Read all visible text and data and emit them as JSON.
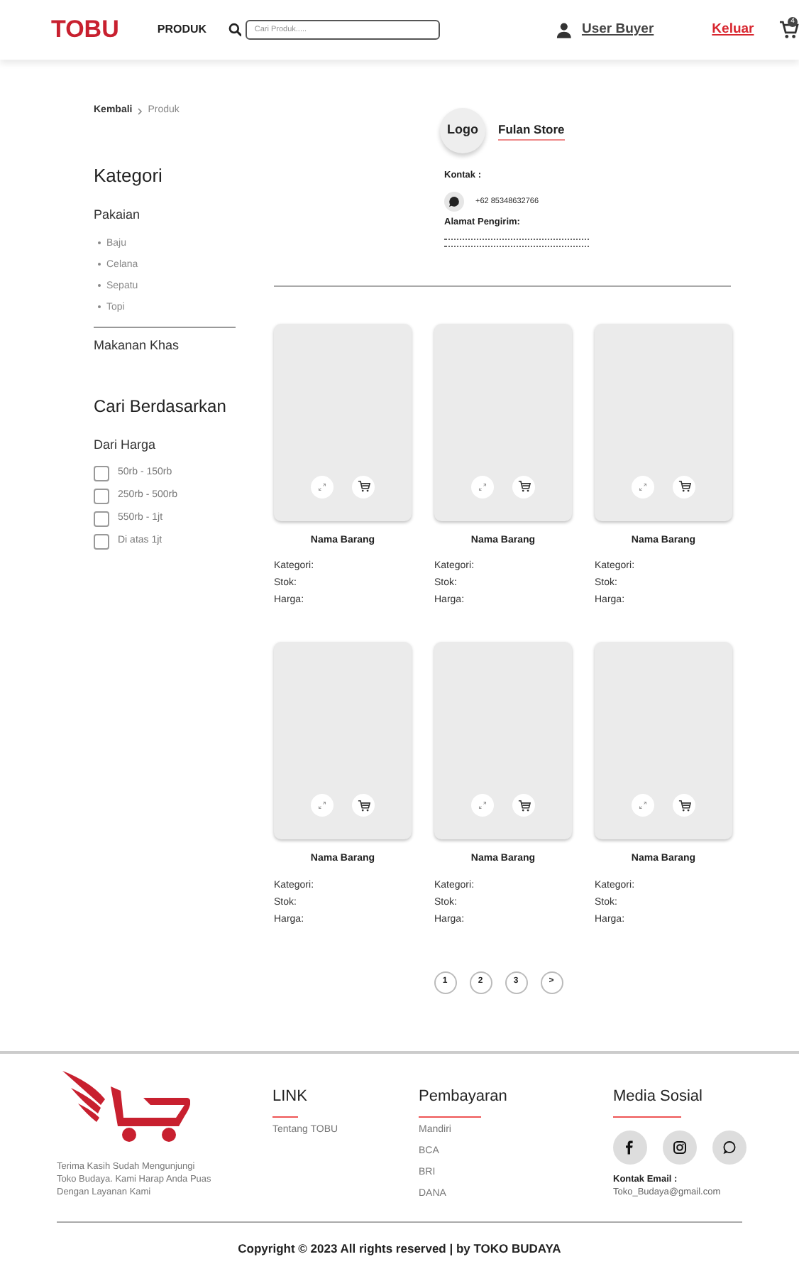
{
  "header": {
    "logo": "TOBU",
    "nav": "PRODUK",
    "search": {
      "placeholder": "Cari Produk....."
    },
    "user": "User Buyer",
    "logout": "Keluar",
    "cart_count": "4"
  },
  "breadcrumb": [
    "Kembali",
    "Produk"
  ],
  "sidebar": {
    "title": "Kategori",
    "categories": [
      {
        "label": "Pakaian",
        "children": [
          {
            "label": "Baju"
          },
          {
            "label": "Celana"
          },
          {
            "label": "Sepatu"
          },
          {
            "label": "Topi"
          }
        ]
      },
      {
        "label": "Makanan Khas"
      }
    ],
    "filter_title": "Cari Berdasarkan",
    "filter_group": "Dari Harga",
    "filters": [
      {
        "label": "50rb - 150rb",
        "checked": false
      },
      {
        "label": "250rb - 500rb",
        "checked": false
      },
      {
        "label": "550rb - 1jt",
        "checked": false
      },
      {
        "label": "Di atas 1jt",
        "checked": false
      }
    ]
  },
  "store": {
    "logo": "Logo",
    "name": "Fulan Store",
    "contact_label": "Kontak :",
    "phone": "+62 85348632766",
    "address_label": "Alamat Pengirim:"
  },
  "products": [
    {
      "name": "Nama Barang",
      "fields": [
        "Kategori:",
        "Stok:",
        "Harga:"
      ]
    },
    {
      "name": "Nama Barang",
      "fields": [
        "Kategori:",
        "Stok:",
        "Harga:"
      ]
    },
    {
      "name": "Nama Barang",
      "fields": [
        "Kategori:",
        "Stok:",
        "Harga:"
      ]
    },
    {
      "name": "Nama Barang",
      "fields": [
        "Kategori:",
        "Stok:",
        "Harga:"
      ]
    },
    {
      "name": "Nama Barang",
      "fields": [
        "Kategori:",
        "Stok:",
        "Harga:"
      ]
    },
    {
      "name": "Nama Barang",
      "fields": [
        "Kategori:",
        "Stok:",
        "Harga:"
      ]
    }
  ],
  "pagination": [
    "1",
    "2",
    "3",
    ">"
  ],
  "footer": {
    "tagline": "Terima Kasih Sudah Mengunjungi Toko Budaya. Kami Harap Anda Puas Dengan Layanan Kami",
    "columns": [
      {
        "title": "LINK",
        "items": [
          "Tentang TOBU"
        ]
      },
      {
        "title": "Pembayaran",
        "items": [
          "Mandiri",
          "BCA",
          "BRI",
          "DANA"
        ]
      }
    ],
    "social_title": "Media Sosial",
    "email_label": "Kontak Email :",
    "email": "Toko_Budaya@gmail.com",
    "copyright": "Copyright © 2023 All rights reserved | by TOKO BUDAYA"
  }
}
